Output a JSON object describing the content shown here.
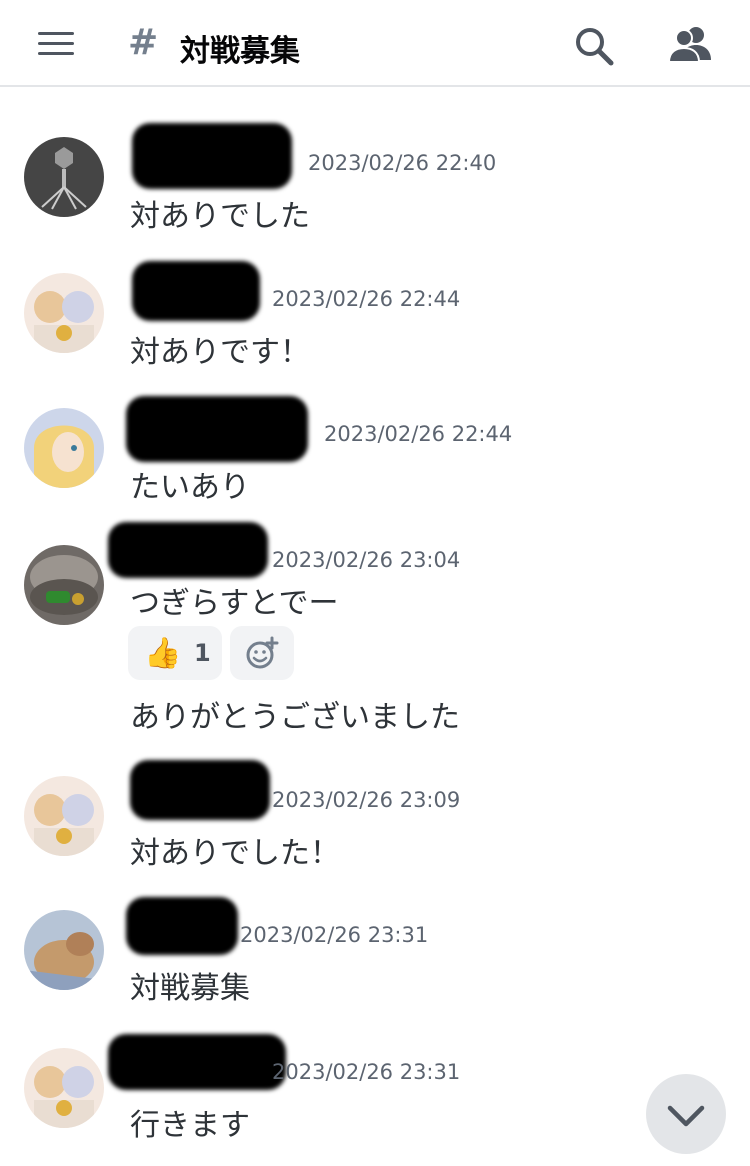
{
  "header": {
    "hash_symbol": "#",
    "channel_name": "対戦募集"
  },
  "messages": [
    {
      "timestamp": "2023/02/26 22:40",
      "text": "対ありでした"
    },
    {
      "timestamp": "2023/02/26 22:44",
      "text": "対ありです！"
    },
    {
      "timestamp": "2023/02/26 22:44",
      "text": "たいあり"
    },
    {
      "timestamp": "2023/02/26 23:04",
      "text": "つぎらすとでー",
      "reaction": {
        "emoji": "👍",
        "count": "1"
      },
      "followup_text": "ありがとうございました"
    },
    {
      "timestamp": "2023/02/26 23:09",
      "text": "対ありでした！"
    },
    {
      "timestamp": "2023/02/26 23:31",
      "text": "対戦募集"
    },
    {
      "timestamp": "2023/02/26 23:31",
      "text": "行きます"
    }
  ],
  "icons": {
    "menu": "hamburger-icon",
    "search": "search-icon",
    "members": "members-icon",
    "add_reaction": "add-reaction-icon",
    "scroll": "chevron-down-icon"
  },
  "colors": {
    "text": "#2e3338",
    "muted": "#5c6470",
    "icon": "#4f5660",
    "reaction_bg": "#f2f3f5"
  }
}
